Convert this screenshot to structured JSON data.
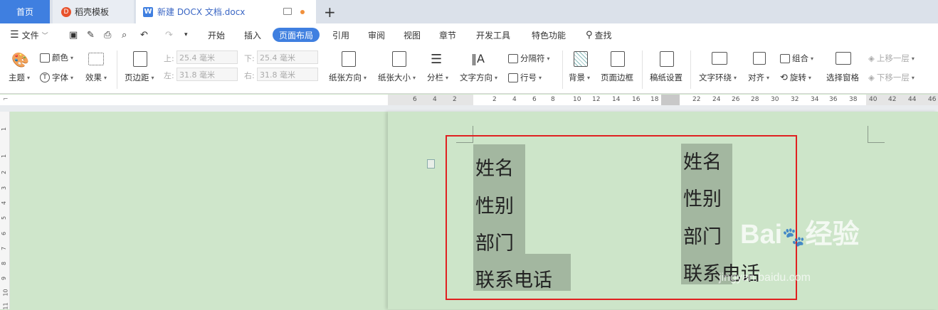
{
  "tabs": {
    "home": "首页",
    "template": "稻壳模板",
    "document": "新建 DOCX 文档.docx",
    "add": "+"
  },
  "menu": {
    "file": "文件",
    "items": [
      "开始",
      "插入",
      "页面布局",
      "引用",
      "审阅",
      "视图",
      "章节",
      "开发工具",
      "特色功能"
    ],
    "active": "页面布局",
    "search": "查找"
  },
  "ribbon": {
    "theme": "主题",
    "color": "颜色",
    "font": "字体",
    "effect": "效果",
    "margin": "页边距",
    "top_label": "上:",
    "top_val": "25.4 毫米",
    "bottom_label": "下:",
    "bottom_val": "25.4 毫米",
    "left_label": "左:",
    "left_val": "31.8 毫米",
    "right_label": "右:",
    "right_val": "31.8 毫米",
    "orientation": "纸张方向",
    "size": "纸张大小",
    "columns": "分栏",
    "text_dir": "文字方向",
    "separator": "分隔符",
    "line_num": "行号",
    "background": "背景",
    "border": "页面边框",
    "draft": "稿纸设置",
    "wrap": "文字环绕",
    "align": "对齐",
    "group": "组合",
    "rotate": "旋转",
    "select_pane": "选择窗格",
    "bring_forward": "上移一层",
    "send_backward": "下移一层"
  },
  "ruler": {
    "h": [
      "6",
      "4",
      "2",
      "2",
      "4",
      "6",
      "8",
      "10",
      "12",
      "14",
      "16",
      "18",
      "22",
      "24",
      "26",
      "28",
      "30",
      "32",
      "34",
      "36",
      "38",
      "40",
      "42",
      "44",
      "46"
    ],
    "v": [
      "1",
      "1",
      "2",
      "3",
      "4",
      "5",
      "6",
      "7",
      "8",
      "9",
      "10",
      "11"
    ]
  },
  "doc": {
    "left": [
      "姓名",
      "性别",
      "部门",
      "联系电话"
    ],
    "right": [
      "姓名",
      "性别",
      "部门",
      "联系电话"
    ]
  },
  "watermark": {
    "brand": "Bai",
    "brand2": "经验",
    "url": "jingyan.baidu.com"
  }
}
